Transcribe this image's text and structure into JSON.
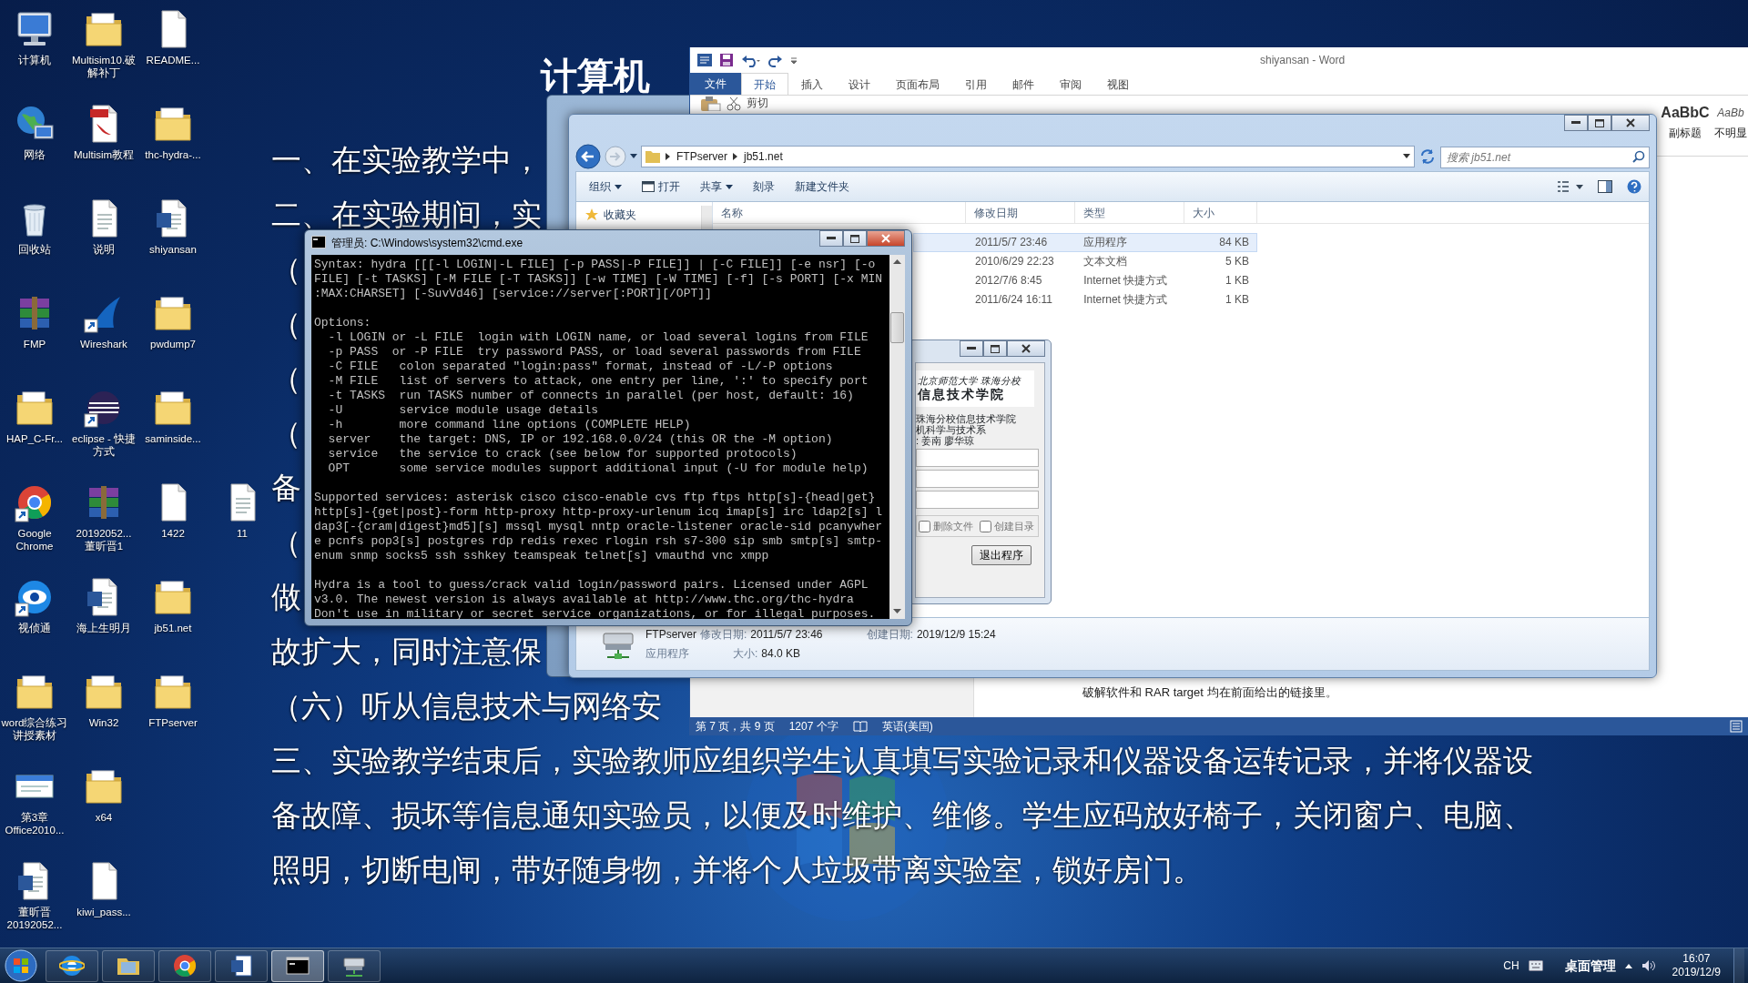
{
  "desktop_rows": [
    [
      {
        "label": "计算机",
        "kind": "computer",
        "shortcut": false
      },
      {
        "label": "Multisim10.破解补丁",
        "kind": "folder",
        "shortcut": false
      },
      {
        "label": "README...",
        "kind": "file",
        "shortcut": false
      }
    ],
    [
      {
        "label": "网络",
        "kind": "network",
        "shortcut": false
      },
      {
        "label": "Multisim教程",
        "kind": "pdf",
        "shortcut": false
      },
      {
        "label": "thc-hydra-...",
        "kind": "folder",
        "shortcut": false
      }
    ],
    [
      {
        "label": "回收站",
        "kind": "recycle",
        "shortcut": false
      },
      {
        "label": "说明",
        "kind": "text",
        "shortcut": false
      },
      {
        "label": "shiyansan",
        "kind": "word",
        "shortcut": false
      }
    ],
    [
      {
        "label": "FMP",
        "kind": "archive",
        "shortcut": false
      },
      {
        "label": "Wireshark",
        "kind": "shark",
        "shortcut": true
      },
      {
        "label": "pwdump7",
        "kind": "folder",
        "shortcut": false
      }
    ],
    [
      {
        "label": "HAP_C-Fr...",
        "kind": "folder",
        "shortcut": false
      },
      {
        "label": "eclipse - 快捷方式",
        "kind": "eclipse",
        "shortcut": true
      },
      {
        "label": "saminside...",
        "kind": "folder",
        "shortcut": false
      }
    ],
    [
      {
        "label": "Google Chrome",
        "kind": "chrome",
        "shortcut": true
      },
      {
        "label": "20192052... 董昕晋1",
        "kind": "archive",
        "shortcut": false
      },
      {
        "label": "1422",
        "kind": "file",
        "shortcut": false
      },
      {
        "label": "11",
        "kind": "text",
        "shortcut": false
      }
    ],
    [
      {
        "label": "视侦通",
        "kind": "eye",
        "shortcut": true
      },
      {
        "label": "海上生明月",
        "kind": "word",
        "shortcut": false
      },
      {
        "label": "jb51.net",
        "kind": "folder",
        "shortcut": false
      }
    ],
    [
      {
        "label": "word综合练习讲授素材",
        "kind": "folder",
        "shortcut": false
      },
      {
        "label": "Win32",
        "kind": "folder",
        "shortcut": false
      },
      {
        "label": "FTPserver",
        "kind": "folder",
        "shortcut": false
      }
    ],
    [
      {
        "label": "第3章 Office2010...",
        "kind": "slide",
        "shortcut": false
      },
      {
        "label": "x64",
        "kind": "folder",
        "shortcut": false
      }
    ],
    [
      {
        "label": "董昕晋 20192052...",
        "kind": "word",
        "shortcut": false
      },
      {
        "label": "kiwi_pass...",
        "kind": "file",
        "shortcut": false
      }
    ]
  ],
  "slide": {
    "title": "计算机",
    "lines": [
      "一、在实验教学中，",
      "二、在实验期间，实",
      "（",
      "（",
      "（",
      "（",
      "备",
      "（",
      "做",
      "故扩大，同时注意保",
      "（六）听从信息技术与网络安",
      "三、实验教学结束后，实验教师应组织学生认真填写实验记录和仪器设备运转记录，并将仪器设",
      "备故障、损坏等信息通知实验员，以便及时维护、维修。学生应码放好椅子，关闭窗户、电脑、",
      "照明，切断电闸，带好随身物，并将个人垃圾带离实验室，锁好房门。"
    ]
  },
  "word": {
    "title": "shiyansan - Word",
    "tabs": [
      {
        "label": "文件",
        "kind": "file",
        "selected": false
      },
      {
        "label": "开始",
        "kind": "tab",
        "selected": true
      },
      {
        "label": "插入",
        "kind": "tab",
        "selected": false
      },
      {
        "label": "设计",
        "kind": "tab",
        "selected": false
      },
      {
        "label": "页面布局",
        "kind": "tab",
        "selected": false
      },
      {
        "label": "引用",
        "kind": "tab",
        "selected": false
      },
      {
        "label": "邮件",
        "kind": "tab",
        "selected": false
      },
      {
        "label": "审阅",
        "kind": "tab",
        "selected": false
      },
      {
        "label": "视图",
        "kind": "tab",
        "selected": false
      }
    ],
    "cut_label": "剪切",
    "styles": [
      {
        "sample": "AaBbC",
        "name": "副标题",
        "kind": "subtitle"
      },
      {
        "sample": "AaBb",
        "name": "不明显",
        "kind": "subtle"
      }
    ],
    "document_text": "破解软件和 RAR target 均在前面给出的链接里。",
    "status": {
      "page": "第 7 页，共 9 页",
      "words": "1207 个字",
      "language": "英语(美国)"
    }
  },
  "explorer": {
    "path": [
      "FTPserver",
      "jb51.net"
    ],
    "search": {
      "placeholder": "搜索 jb51.net"
    },
    "toolbar": [
      {
        "label": "组织",
        "kind": "menu"
      },
      {
        "label": "打开",
        "kind": "open"
      },
      {
        "label": "共享",
        "kind": "menu"
      },
      {
        "label": "刻录",
        "kind": "plain"
      },
      {
        "label": "新建文件夹",
        "kind": "plain"
      }
    ],
    "nav": [
      {
        "label": "收藏夹"
      }
    ],
    "columns": [
      "名称",
      "修改日期",
      "类型",
      "大小"
    ],
    "rows": [
      {
        "modified": "2011/5/7 23:46",
        "type": "应用程序",
        "size": "84 KB",
        "selected": true
      },
      {
        "modified": "2010/6/29 22:23",
        "type": "文本文档",
        "size": "5 KB",
        "selected": false
      },
      {
        "modified": "2012/7/6 8:45",
        "type": "Internet 快捷方式",
        "size": "1 KB",
        "selected": false
      },
      {
        "modified": "2011/6/24 16:11",
        "type": "Internet 快捷方式",
        "size": "1 KB",
        "selected": false
      }
    ],
    "details": {
      "name": "FTPserver",
      "modified_label": "修改日期:",
      "modified": "2011/5/7 23:46",
      "created_label": "创建日期:",
      "created": "2019/12/9 15:24",
      "type": "应用程序",
      "size_label": "大小:",
      "size": "84.0 KB"
    }
  },
  "dialog": {
    "logo": [
      "北京师范大学 珠海分校",
      "信息技术学院"
    ],
    "info": [
      "珠海分校信息技术学院",
      "机科学与技术系",
      ": 姜南 廖华琼"
    ],
    "checkboxes": [
      {
        "label": "删除文件",
        "checked": false
      },
      {
        "label": "创建目录",
        "checked": false
      }
    ],
    "button": "退出程序"
  },
  "cmd": {
    "title": "管理员: C:\\Windows\\system32\\cmd.exe",
    "output": [
      [
        "Syntax: hydra [[[-l LOGIN|-L FILE] [-p PASS|-P FILE]] | [-C FILE]] [-e nsr] [-o",
        "FILE] [-t TASKS] [-M FILE [-T TASKS]] [-w TIME] [-W TIME] [-f] [-s PORT] [-x MIN",
        ":MAX:CHARSET] [-SuvVd46] [service://server[:PORT][/OPT]]"
      ],
      [
        "Options:",
        "  -l LOGIN or -L FILE  login with LOGIN name, or load several logins from FILE",
        "  -p PASS  or -P FILE  try password PASS, or load several passwords from FILE",
        "  -C FILE   colon separated \"login:pass\" format, instead of -L/-P options",
        "  -M FILE   list of servers to attack, one entry per line, ':' to specify port",
        "  -t TASKS  run TASKS number of connects in parallel (per host, default: 16)",
        "  -U        service module usage details",
        "  -h        more command line options (COMPLETE HELP)",
        "  server    the target: DNS, IP or 192.168.0.0/24 (this OR the -M option)",
        "  service   the service to crack (see below for supported protocols)",
        "  OPT       some service modules support additional input (-U for module help)"
      ],
      [
        "Supported services: asterisk cisco cisco-enable cvs ftp ftps http[s]-{head|get}",
        "http[s]-{get|post}-form http-proxy http-proxy-urlenum icq imap[s] irc ldap2[s] l",
        "dap3[-{cram|digest}md5][s] mssql mysql nntp oracle-listener oracle-sid pcanywher",
        "e pcnfs pop3[s] postgres rdp redis rexec rlogin rsh s7-300 sip smb smtp[s] smtp-",
        "enum snmp socks5 ssh sshkey teamspeak telnet[s] vmauthd vnc xmpp"
      ],
      [
        "Hydra is a tool to guess/crack valid login/password pairs. Licensed under AGPL",
        "v3.0. The newest version is always available at http://www.thc.org/thc-hydra",
        "Don't use in military or secret service organizations, or for illegal purposes."
      ]
    ]
  },
  "taskbar": {
    "items": [
      {
        "kind": "ie",
        "active": false
      },
      {
        "kind": "explorer",
        "active": false
      },
      {
        "kind": "chrome",
        "active": false
      },
      {
        "kind": "word",
        "active": false
      },
      {
        "kind": "cmd",
        "active": true
      },
      {
        "kind": "server",
        "active": false
      }
    ],
    "language": "CH",
    "toolbar_label": "桌面管理",
    "time": "16:07",
    "date": "2019/12/9"
  }
}
